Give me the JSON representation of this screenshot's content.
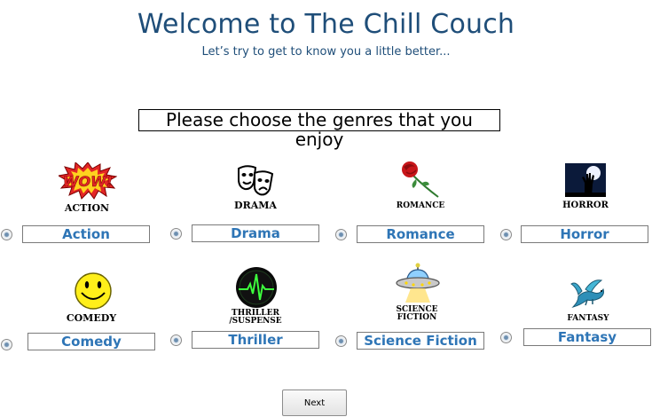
{
  "header": {
    "title": "Welcome to The Chill Couch",
    "subtitle": "Let’s try to get to know you a little better..."
  },
  "prompt": "Please choose the genres that you enjoy",
  "genres": [
    {
      "label": "Action",
      "caption": "ACTION",
      "icon": "wow-burst-icon"
    },
    {
      "label": "Drama",
      "caption": "DRAMA",
      "icon": "theater-masks-icon"
    },
    {
      "label": "Romance",
      "caption": "ROMANCE",
      "icon": "rose-icon"
    },
    {
      "label": "Horror",
      "caption": "HORROR",
      "icon": "zombie-hand-icon"
    },
    {
      "label": "Comedy",
      "caption": "COMEDY",
      "icon": "smiley-face-icon"
    },
    {
      "label": "Thriller",
      "caption_line1": "THRILLER",
      "caption_line2": "/SUSPENSE",
      "icon": "heartbeat-monitor-icon"
    },
    {
      "label": "Science Fiction",
      "caption_line1": "SCIENCE",
      "caption_line2": "FICTION",
      "icon": "ufo-icon"
    },
    {
      "label": "Fantasy",
      "caption": "FANTASY",
      "icon": "dragon-icon"
    }
  ],
  "next_label": "Next",
  "colors": {
    "title": "#1f4e79",
    "option_text": "#2e75b6"
  }
}
